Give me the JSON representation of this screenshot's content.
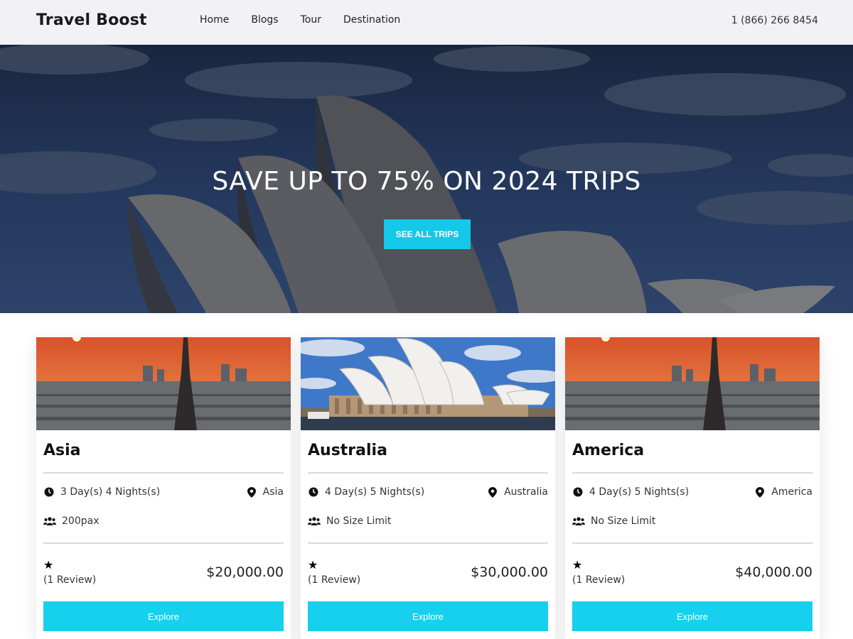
{
  "header": {
    "brand": "Travel Boost",
    "nav": [
      "Home",
      "Blogs",
      "Tour",
      "Destination"
    ],
    "phone": "1 (866) 266 8454"
  },
  "hero": {
    "title": "SAVE UP TO 75% ON 2024 TRIPS",
    "button": "SEE ALL TRIPS"
  },
  "accent_color": "#16c8e8",
  "cards": [
    {
      "title": "Asia",
      "duration": "3 Day(s) 4 Nights(s)",
      "location": "Asia",
      "group": "200pax",
      "reviews": "(1 Review)",
      "price": "$20,000.00",
      "button": "Explore",
      "image": "paris-sunset"
    },
    {
      "title": "Australia",
      "duration": "4 Day(s) 5 Nights(s)",
      "location": "Australia",
      "group": "No Size Limit",
      "reviews": "(1 Review)",
      "price": "$30,000.00",
      "button": "Explore",
      "image": "sydney-opera-house"
    },
    {
      "title": "America",
      "duration": "4 Day(s) 5 Nights(s)",
      "location": "America",
      "group": "No Size Limit",
      "reviews": "(1 Review)",
      "price": "$40,000.00",
      "button": "Explore",
      "image": "paris-sunset"
    }
  ]
}
